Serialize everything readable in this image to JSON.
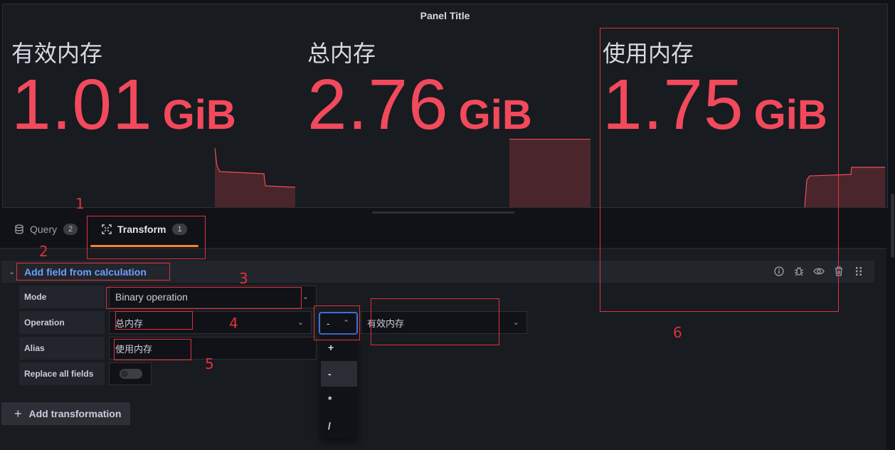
{
  "panel": {
    "title": "Panel Title",
    "stats": [
      {
        "label": "有效内存",
        "value": "1.01",
        "unit": "GiB"
      },
      {
        "label": "总内存",
        "value": "2.76",
        "unit": "GiB"
      },
      {
        "label": "使用内存",
        "value": "1.75",
        "unit": "GiB"
      }
    ],
    "accent_color": "#f2495c"
  },
  "tabs": [
    {
      "label": "Query",
      "count": "2",
      "icon": "database-icon"
    },
    {
      "label": "Transform",
      "count": "1",
      "icon": "transform-icon",
      "active": true
    }
  ],
  "transformation": {
    "title": "Add field from calculation",
    "actions": [
      "info-icon",
      "bug-icon",
      "eye-icon",
      "trash-icon",
      "drag-handle-icon"
    ],
    "fields": {
      "mode_label": "Mode",
      "mode_value": "Binary operation",
      "operation_label": "Operation",
      "operation_left": "总内存",
      "operator": "-",
      "operation_right": "有效内存",
      "alias_label": "Alias",
      "alias_value": "使用内存",
      "replace_label": "Replace all fields",
      "replace_value": false
    },
    "operator_options": [
      "+",
      "-",
      "*",
      "/"
    ],
    "operator_selected": "-"
  },
  "add_transformation_label": "Add transformation",
  "annotations": [
    "1",
    "2",
    "3",
    "4",
    "5",
    "6"
  ]
}
